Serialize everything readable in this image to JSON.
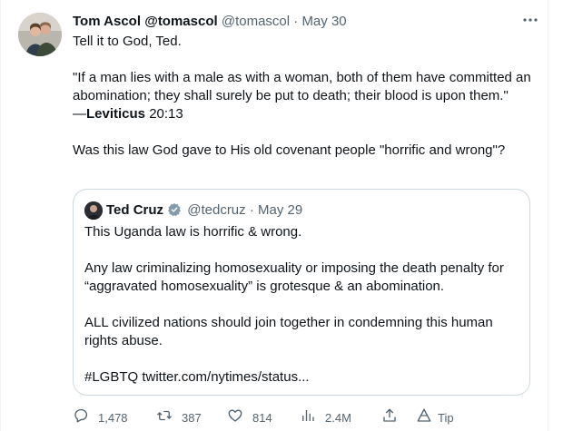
{
  "author": {
    "display_name": "Tom Ascol",
    "handle_link": "@tomascol",
    "handle": "@tomascol",
    "date": "May 30"
  },
  "body": {
    "line1": "Tell it to God, Ted.",
    "quote_text": "\"If a man lies with a male as with a woman, both of them have committed an abomination; they shall surely be put to death; their blood is upon them.\"",
    "cite_prefix": "—",
    "cite_book": "Leviticus",
    "cite_ref": " 20:13",
    "question": "Was this law God gave to His old covenant people \"horrific and wrong\"?"
  },
  "quoted_tweet": {
    "display_name": "Ted Cruz",
    "handle": "@tedcruz",
    "date": "May 29",
    "line1": "This Uganda law is horrific & wrong.",
    "line2": "Any law criminalizing homosexuality or imposing the death penalty for “aggravated homosexuality” is grotesque & an abomination.",
    "line3": "ALL civilized nations should join together in condemning this human rights abuse.",
    "line4": "#LGBTQ twitter.com/nytimes/status..."
  },
  "actions": {
    "replies": "1,478",
    "retweets": "387",
    "likes": "814",
    "views": "2.4M",
    "tip_label": "Tip"
  },
  "icons": {
    "more": "more-icon",
    "reply": "reply-icon",
    "retweet": "retweet-icon",
    "like": "heart-icon",
    "views": "views-icon",
    "share": "share-icon",
    "tip": "tip-icon",
    "verified": "verified-badge-icon"
  },
  "colors": {
    "text": "#0f1419",
    "secondary": "#536471",
    "border": "#cfd9de",
    "verified": "#829aab"
  }
}
